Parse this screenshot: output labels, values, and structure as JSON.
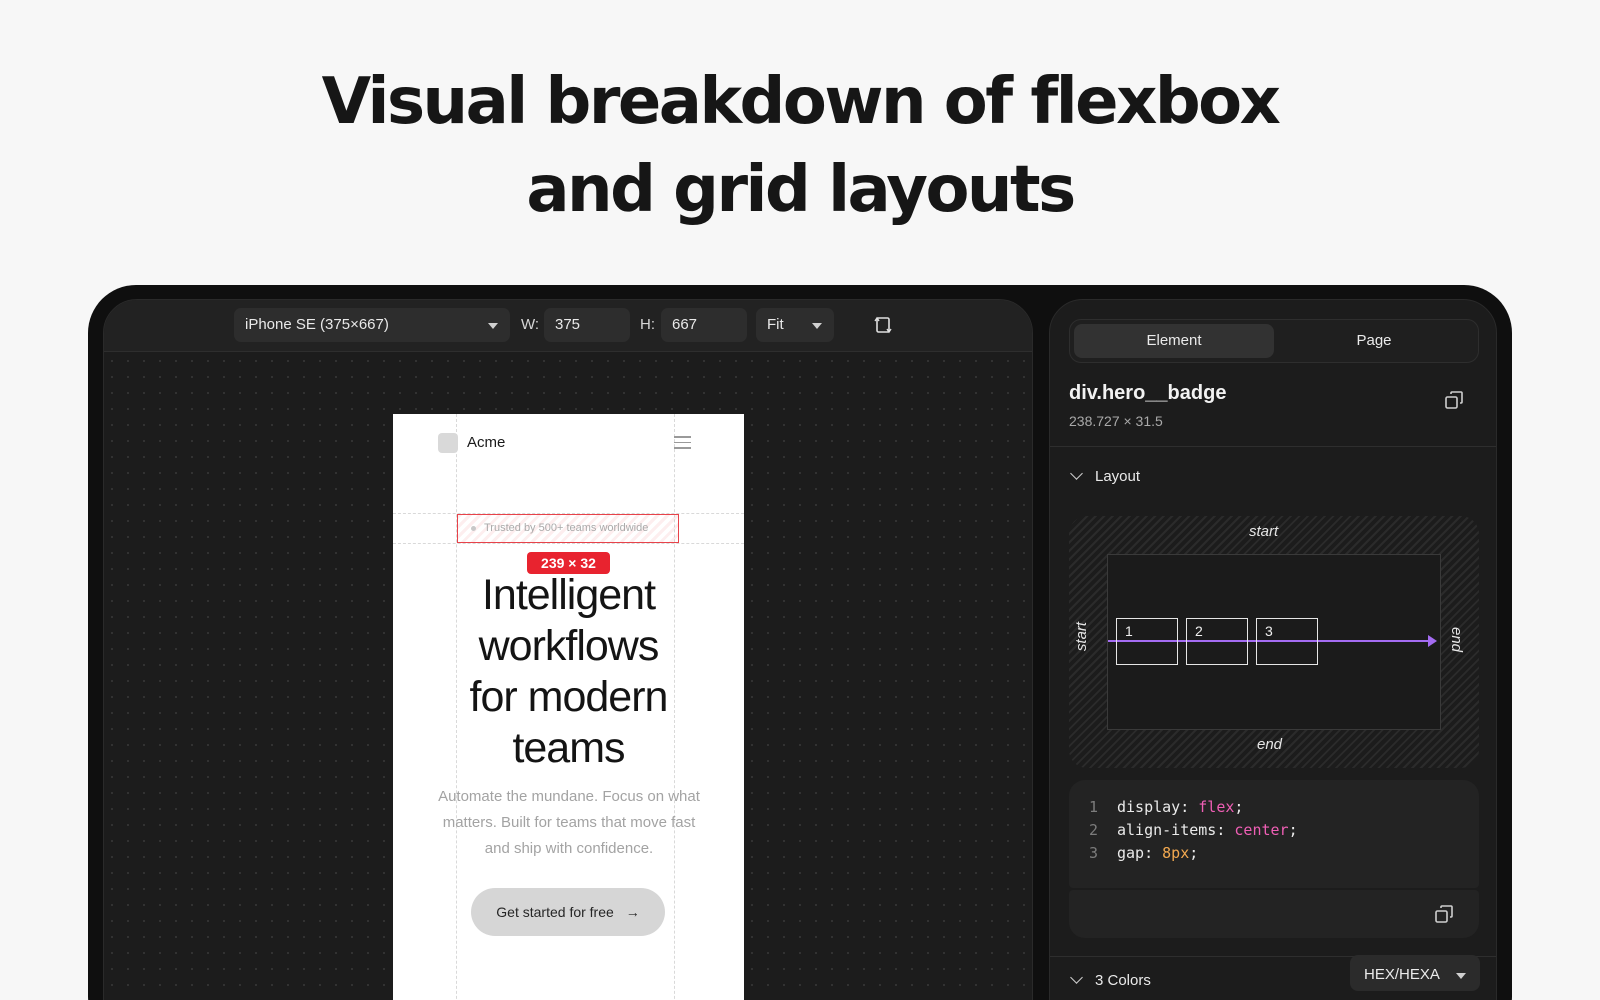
{
  "headline": {
    "line1": "Visual breakdown of flexbox",
    "line2": "and grid layouts"
  },
  "toolbar": {
    "device_select": "iPhone SE (375×667)",
    "width_label": "W:",
    "width_value": "375",
    "height_label": "H:",
    "height_value": "667",
    "zoom_select": "Fit"
  },
  "preview": {
    "brand": "Acme",
    "badge_text": "Trusted by 500+ teams worldwide",
    "dimension_tag": "239 × 32",
    "title_lines": [
      "Intelligent",
      "workflows",
      "for modern",
      "teams"
    ],
    "subtitle": "Automate the mundane. Focus on what matters. Built for teams that move fast and ship with confidence.",
    "cta_label": "Get started for free",
    "cta_arrow": "→"
  },
  "inspector": {
    "tabs": [
      "Element",
      "Page"
    ],
    "active_tab": "Element",
    "element_name": "div.hero__badge",
    "element_size": "238.727 × 31.5",
    "layout_section": "Layout",
    "layout_viz": {
      "cross_start": "start",
      "cross_end": "end",
      "main_start": "start",
      "main_end": "end",
      "items": [
        "1",
        "2",
        "3"
      ]
    },
    "code": [
      {
        "n": "1",
        "prop": "display",
        "value": "flex"
      },
      {
        "n": "2",
        "prop": "align-items",
        "value": "center"
      },
      {
        "n": "3",
        "prop": "gap",
        "value": "8px"
      }
    ],
    "colors_section": "3 Colors",
    "color_format": "HEX/HEXA"
  },
  "colors": {
    "accent_red": "#e8232f",
    "axis_purple": "#a46cf2",
    "code_pink": "#ef5fb5",
    "code_amber": "#f3a950"
  },
  "icons": [
    "caret-down-icon",
    "rotate-icon",
    "hamburger-icon",
    "copy-icon",
    "chevron-down-icon",
    "arrow-right-icon"
  ]
}
